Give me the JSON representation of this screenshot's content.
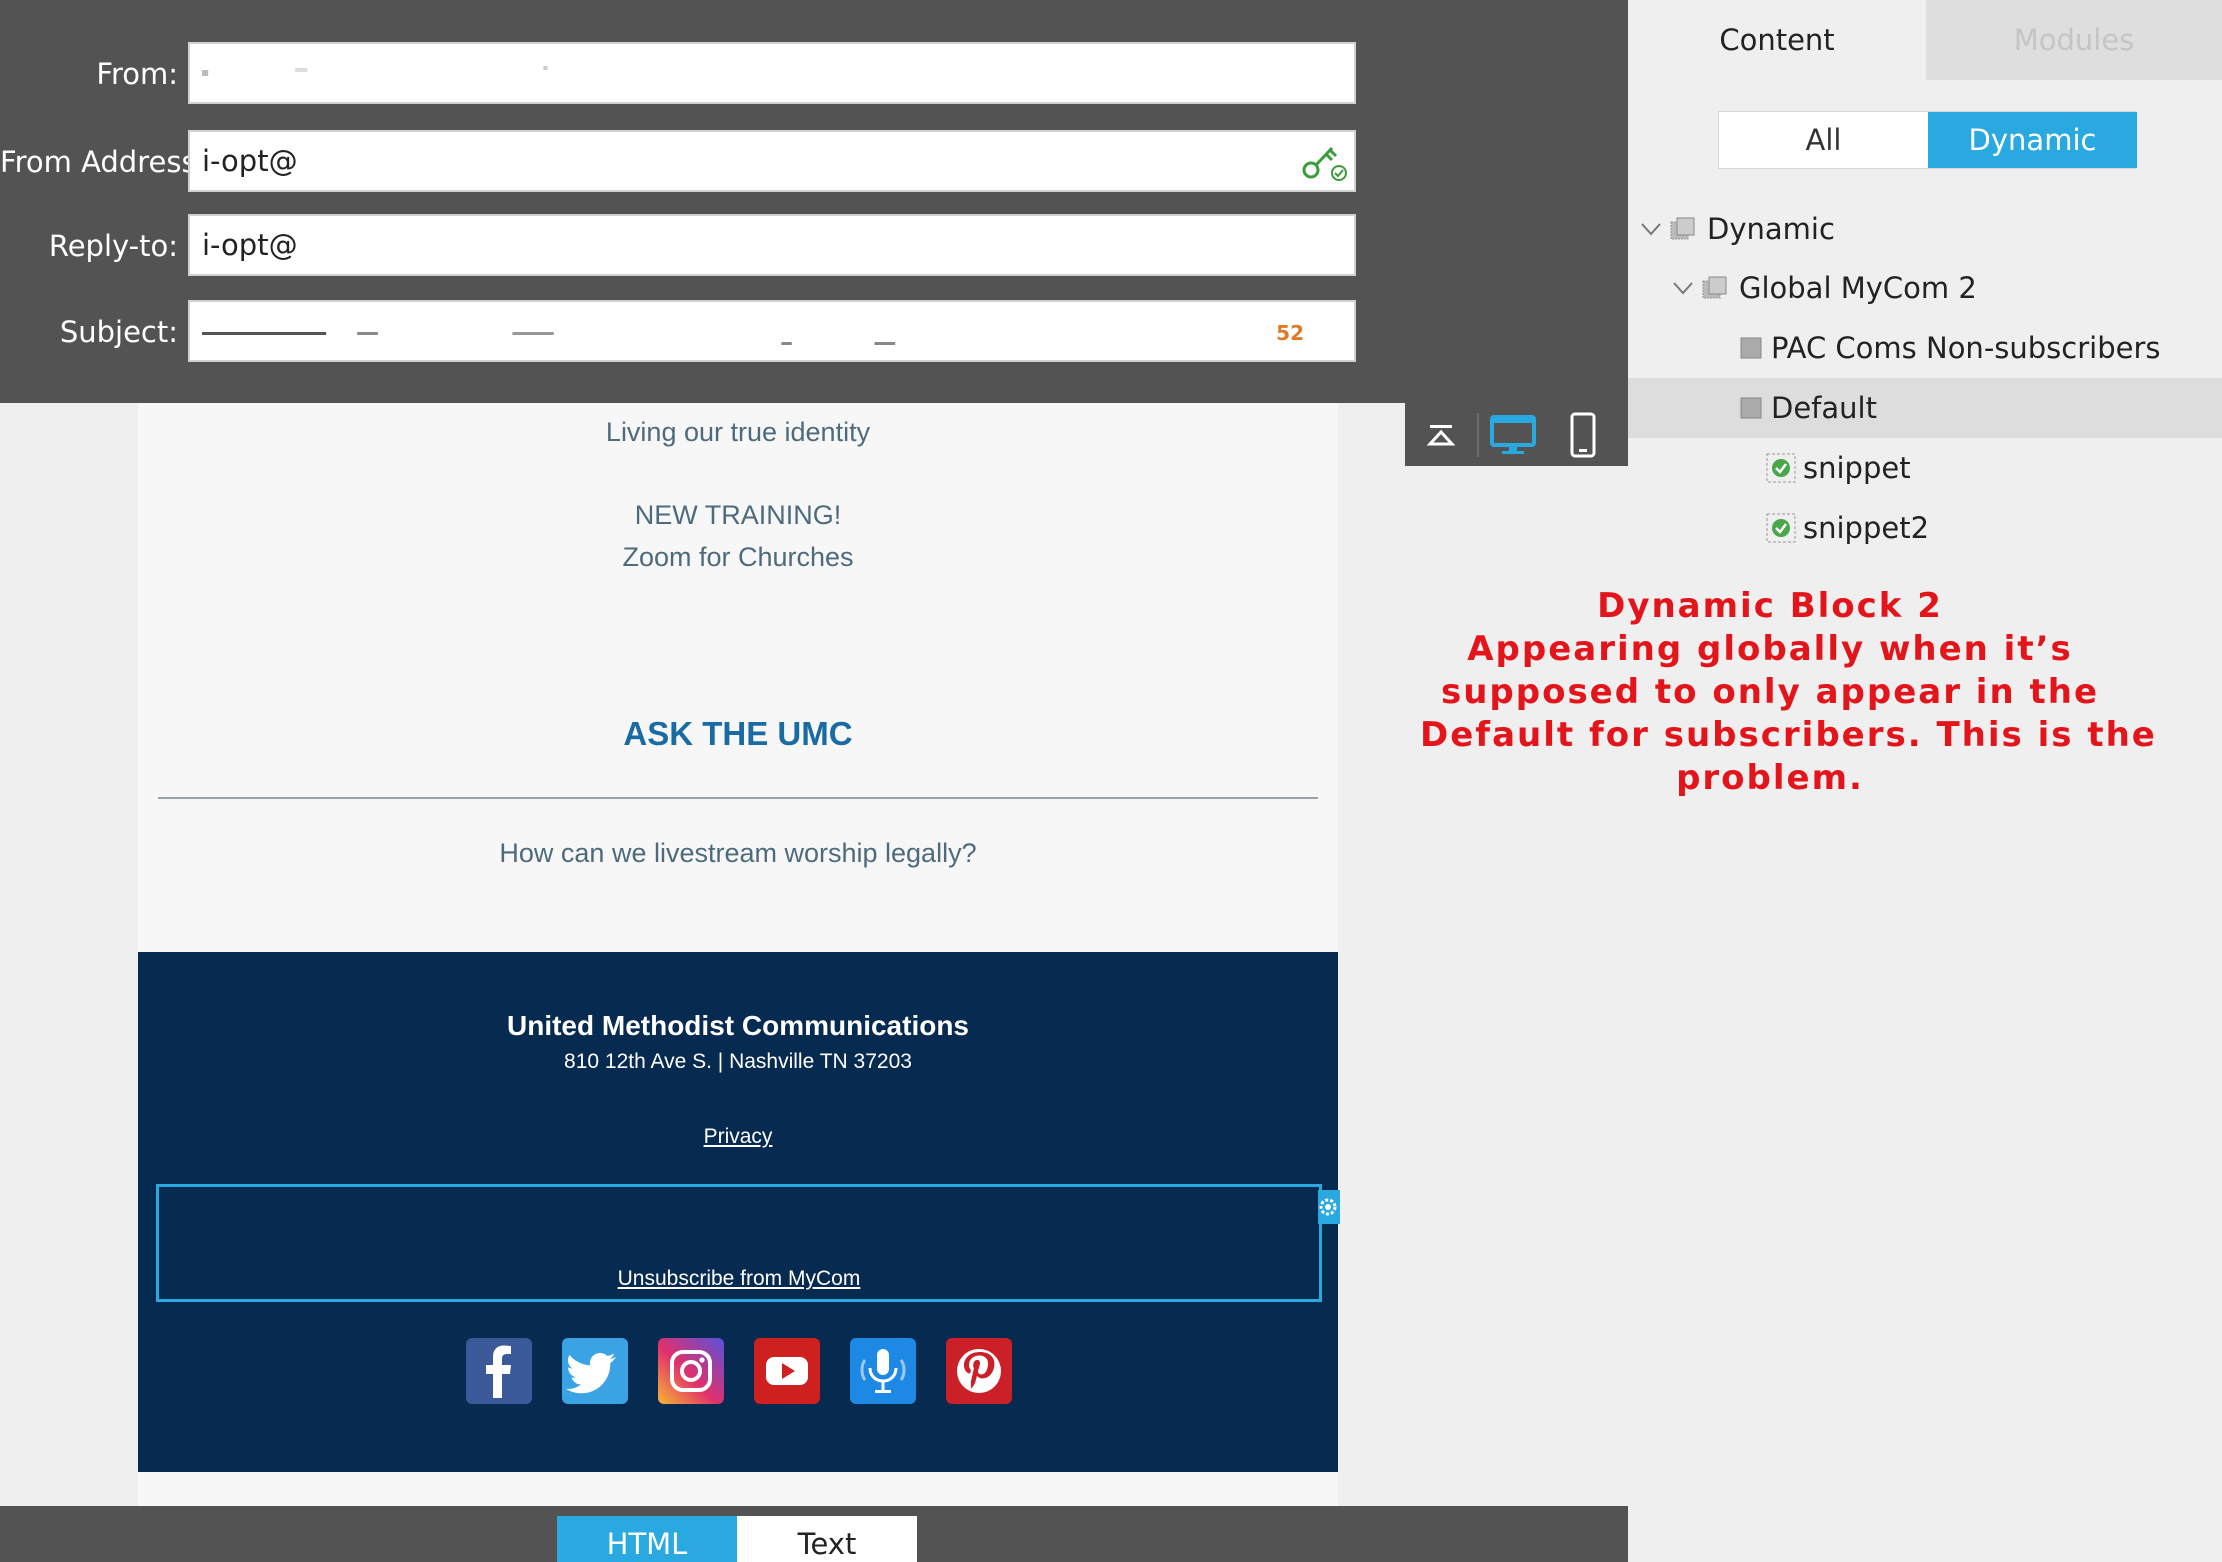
{
  "header": {
    "from_label": "From:",
    "from_value": "",
    "from_address_label": "From Address:",
    "from_address_value": "i-opt@",
    "reply_to_label": "Reply-to:",
    "reply_to_value": "i-opt@",
    "subject_label": "Subject:",
    "subject_value": "",
    "subject_char_count": "52"
  },
  "email": {
    "line1": "Living our true identity",
    "line2": "NEW TRAINING!",
    "line3": "Zoom for Churches",
    "ask_heading": "ASK THE UMC",
    "question": "How can we livestream worship legally?",
    "footer": {
      "org": "United Methodist Communications",
      "address": "810 12th Ave S. | Nashville TN 37203",
      "privacy": "Privacy",
      "unsubscribe": "Unsubscribe from MyCom",
      "social": [
        {
          "name": "facebook-icon",
          "color": "#3b5998"
        },
        {
          "name": "twitter-icon",
          "color": "#1da1f2"
        },
        {
          "name": "instagram-icon",
          "color": "#c13584"
        },
        {
          "name": "youtube-icon",
          "color": "#cd201f"
        },
        {
          "name": "podcast-icon",
          "color": "#1e88e5"
        },
        {
          "name": "pinterest-icon",
          "color": "#cb2027"
        }
      ]
    }
  },
  "preview_toolbar": {
    "collapse_icon": "collapse-up-icon",
    "desktop_icon": "desktop-icon",
    "mobile_icon": "mobile-icon",
    "active": "desktop"
  },
  "bottom_tabs": {
    "html_label": "HTML",
    "text_label": "Text",
    "active": "HTML"
  },
  "right_panel": {
    "tabs": [
      "Content",
      "Modules"
    ],
    "active_tab": "Content",
    "filter": [
      "All",
      "Dynamic"
    ],
    "active_filter": "Dynamic",
    "tree": [
      {
        "label": "Dynamic",
        "level": 0,
        "expanded": true,
        "icon": "module-stack-icon"
      },
      {
        "label": "Global MyCom 2",
        "level": 1,
        "expanded": true,
        "icon": "module-stack-icon"
      },
      {
        "label": "PAC Coms Non-subscribers",
        "level": 2,
        "icon": "segment-square-icon"
      },
      {
        "label": "Default",
        "level": 2,
        "icon": "segment-square-icon",
        "selected": true
      },
      {
        "label": "snippet",
        "level": 3,
        "icon": "snippet-check-icon"
      },
      {
        "label": "snippet2",
        "level": 3,
        "icon": "snippet-check-icon"
      }
    ]
  },
  "annotation": {
    "lines": [
      "Dynamic Block 2",
      "Appearing globally when it’s",
      "supposed to only appear in the",
      "Default for subscribers. This is the",
      "problem."
    ],
    "color": "#e3141a"
  },
  "colors": {
    "accent": "#29a9e0",
    "header_bg": "#535353",
    "footer_bg": "#062a50"
  }
}
